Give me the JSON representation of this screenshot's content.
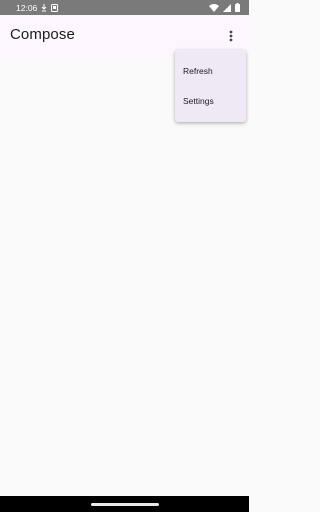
{
  "status_bar": {
    "time": "12:06",
    "icons": [
      "data-saver-icon",
      "screenshot-icon",
      "wifi-icon",
      "signal-icon",
      "battery-icon"
    ]
  },
  "app_bar": {
    "title": "Compose",
    "overflow_icon": "more-vert-icon"
  },
  "menu": {
    "items": [
      {
        "label": "Refresh"
      },
      {
        "label": "Settings"
      }
    ]
  },
  "colors": {
    "status_bar": "#7a7a7a",
    "app_bar": "#fdf6fe",
    "menu_background": "#efe8f5",
    "background": "#fafafa",
    "nav_bar": "#000000"
  }
}
